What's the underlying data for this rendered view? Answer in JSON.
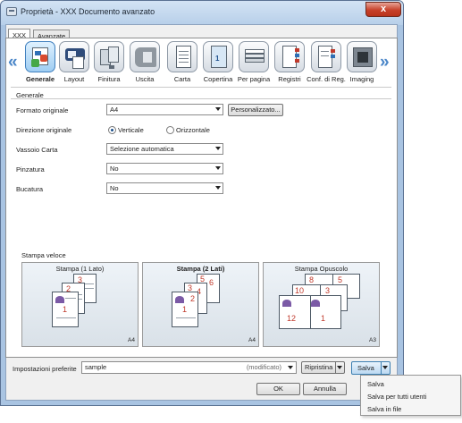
{
  "window": {
    "title": "Proprietà - XXX Documento avanzato",
    "close_label": "x"
  },
  "tabs": [
    {
      "label": "XXX"
    },
    {
      "label": "Avanzate"
    }
  ],
  "categories": [
    {
      "label": "Generale"
    },
    {
      "label": "Layout"
    },
    {
      "label": "Finitura"
    },
    {
      "label": "Uscita"
    },
    {
      "label": "Carta"
    },
    {
      "label": "Copertina"
    },
    {
      "label": "Per pagina"
    },
    {
      "label": "Registri"
    },
    {
      "label": "Conf. di Reg."
    },
    {
      "label": "Imaging"
    }
  ],
  "nav": {
    "prev": "«",
    "next": "»"
  },
  "general": {
    "section_title": "Generale",
    "original_size": {
      "label": "Formato originale",
      "value": "A4",
      "custom_button": "Personalizzato..."
    },
    "orientation": {
      "label": "Direzione originale",
      "portrait": "Verticale",
      "landscape": "Orizzontale"
    },
    "paper_tray": {
      "label": "Vassoio Carta",
      "value": "Selezione automatica"
    },
    "staple": {
      "label": "Pinzatura",
      "value": "No"
    },
    "punch": {
      "label": "Bucatura",
      "value": "No"
    }
  },
  "quick_print": {
    "title": "Stampa veloce",
    "cards": [
      {
        "title": "Stampa (1 Lato)",
        "size": "A4",
        "pages": [
          "1",
          "2",
          "3"
        ]
      },
      {
        "title": "Stampa (2 Lati)",
        "size": "A4",
        "pages": [
          "1",
          "2",
          "3",
          "4",
          "5",
          "6"
        ]
      },
      {
        "title": "Stampa Opuscolo",
        "size": "A3",
        "pages": [
          "12",
          "1",
          "10",
          "3",
          "8",
          "5"
        ]
      }
    ]
  },
  "favorites": {
    "label": "Impostazioni preferite",
    "value": "sample",
    "status": "(modificato)",
    "restore_button": "Ripristina",
    "save_button": "Salva"
  },
  "dialog_buttons": {
    "ok": "OK",
    "cancel": "Annulla"
  },
  "save_menu": [
    {
      "label": "Salva"
    },
    {
      "label": "Salva per tutti utenti"
    },
    {
      "label": "Salva in file"
    }
  ]
}
